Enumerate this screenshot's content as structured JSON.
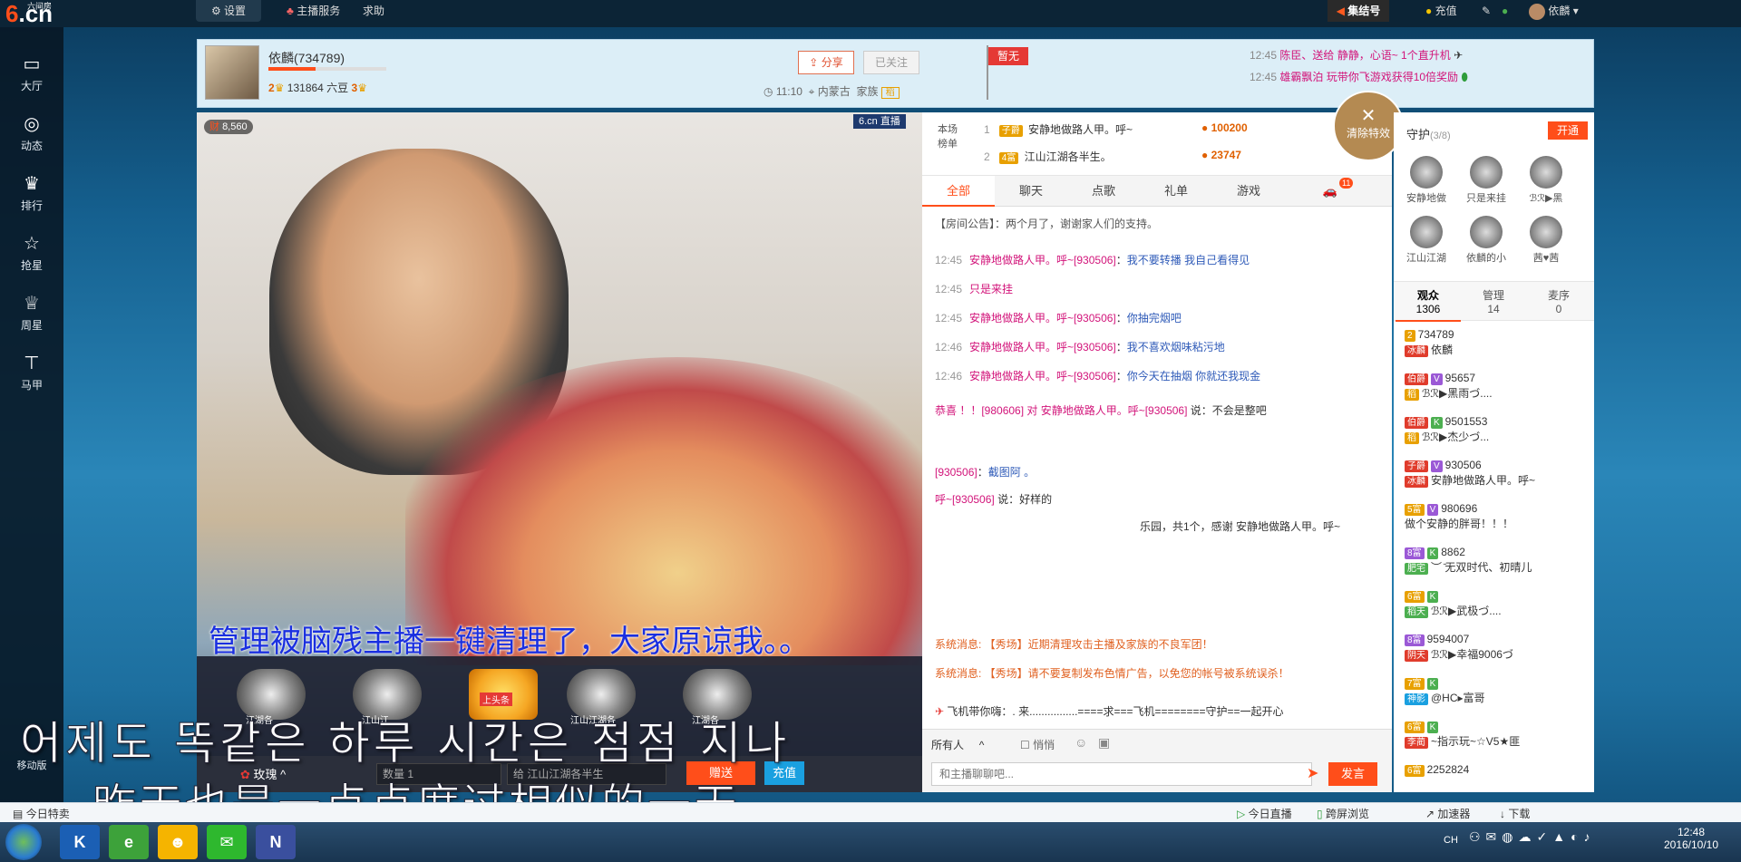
{
  "topbar": {
    "logo_cn": "六间房",
    "logo_text": "6.cn",
    "settings": "设置",
    "anchor_service": "主播服务",
    "help": "求助",
    "jiejie": "集结号",
    "recharge": "充值",
    "user": "依麟"
  },
  "rail": {
    "items": [
      "大厅",
      "动态",
      "排行",
      "抢星",
      "周星",
      "马甲"
    ],
    "mobile": "移动版"
  },
  "header": {
    "anchor_name": "依麟(734789)",
    "level_left": "2",
    "beans": "131864 六豆",
    "level_right": "3",
    "share": "分享",
    "followed": "已关注",
    "time": "11:10",
    "location": "内蒙古",
    "family": "家族",
    "family_badge": "稻",
    "flag": "暂无",
    "feed": [
      {
        "time": "12:45",
        "text": "陈臣、送给 静静，心语~ 1个直升机"
      },
      {
        "time": "12:45",
        "text": "雄霸飘泊 玩带你飞游戏获得10倍奖励"
      }
    ]
  },
  "video": {
    "watermark": "6.cn 直播",
    "wealth_badge": "财",
    "wealth_value": "8,560",
    "gift_labels": [
      "江湖各",
      "江山江",
      "上头条",
      "江山江湖各",
      "江湖各"
    ],
    "gift_name": "玫瑰",
    "quantity_label": "数量",
    "quantity": "1",
    "recipient": "给 江山江湖各半生",
    "give": "赠送",
    "recharge": "充值"
  },
  "rank": {
    "label": "本场榜单",
    "rows": [
      {
        "rank": "1",
        "badge": "子爵",
        "name": "安静地做路人甲。呼~",
        "score": "100200"
      },
      {
        "rank": "2",
        "badge": "4富",
        "name": "江山江湖各半生。",
        "score": "23747"
      }
    ],
    "clear_effects": "清除特效"
  },
  "chat": {
    "tabs": [
      "全部",
      "聊天",
      "点歌",
      "礼单",
      "游戏"
    ],
    "car_badge": "11",
    "announcement": "【房间公告】：两个月了，谢谢家人们的支持。",
    "messages": [
      {
        "time": "12:45",
        "name": "安静地做路人甲。呼~[930506]",
        "text": "我不要转播 我自己看得见"
      },
      {
        "time": "12:45",
        "name": "只是来挂",
        "text": ""
      },
      {
        "time": "12:45",
        "name": "安静地做路人甲。呼~[930506]",
        "text": "你抽完烟吧"
      },
      {
        "time": "12:46",
        "name": "安静地做路人甲。呼~[930506]",
        "text": "我不喜欢烟味粘污地"
      },
      {
        "time": "12:46",
        "name": "安静地做路人甲。呼~[930506]",
        "text": "你今天在抽烟 你就还我现金"
      },
      {
        "time": "",
        "name": "恭喜 ！！[980606] 对 安静地做路人甲。呼~[930506]",
        "text": "说：不会是整吧"
      },
      {
        "time": "",
        "name": "[930506]",
        "text": "截图阿 。"
      },
      {
        "time": "",
        "name": "呼~[930506]",
        "text": "说：好样的"
      },
      {
        "time": "",
        "name": "乐园，共1个，感谢 安静地做路人甲。呼~",
        "text": ""
      }
    ],
    "sys1": "系统消息: 【秀场】近期清理攻击主播及家族的不良军团！",
    "sys2": "系统消息: 【秀场】请不要复制发布色情广告，以免您的帐号被系统误杀！",
    "plane": "飞机带你嗨：. 来................====求===飞机========守护==一起开心",
    "to_all": "所有人",
    "whisper": "悄悄",
    "input_placeholder": "和主播聊聊吧...",
    "send": "发言"
  },
  "guard": {
    "title": "守护",
    "count": "(3/8)",
    "open": "开通",
    "members": [
      "安静地做",
      "只是来挂",
      "ℬℛ▶黑",
      "江山江湖",
      "依麟的小",
      "茜♥茜"
    ]
  },
  "audience": {
    "tabs": [
      {
        "label": "观众",
        "count": "1306"
      },
      {
        "label": "管理",
        "count": "14"
      },
      {
        "label": "麦序",
        "count": "0"
      }
    ],
    "list": [
      {
        "id": "734789",
        "badge": "冰麟",
        "name": "依麟"
      },
      {
        "id": "95657",
        "badge": "稻",
        "name": "ℬℛ▶黑雨づ...."
      },
      {
        "id": "9501553",
        "badge": "稻",
        "name": "ℬℛ▶杰少づ..."
      },
      {
        "id": "930506",
        "badge": "冰麟",
        "name": "安静地做路人甲。呼~"
      },
      {
        "id": "980696",
        "badge": "",
        "name": "做个安静的胖哥！！！"
      },
      {
        "id": "8862",
        "badge": "肥宅",
        "name": "︶ ̄无双时代、初晴儿"
      },
      {
        "id": "",
        "badge": "稻天",
        "name": "ℬℛ▶武极づ...."
      },
      {
        "id": "9594007",
        "badge": "阴天",
        "name": "ℬℛ▶幸福9006づ"
      },
      {
        "id": "",
        "badge": "神影",
        "name": "@HC▸富哥"
      },
      {
        "id": "",
        "badge": "李蔺",
        "name": "~指示玩~☆V5★匪"
      },
      {
        "id": "2252824",
        "badge": "",
        "name": ""
      }
    ]
  },
  "statusbar": {
    "left": "今日特卖",
    "live_today": "今日直播",
    "cross_browse": "跨屏浏览",
    "accelerator": "加速器",
    "download": "下载"
  },
  "taskbar": {
    "lang": "CH",
    "time": "12:48",
    "date": "2016/10/10"
  },
  "subtitles": {
    "line1": "管理被脑残主播一键清理了，大家原谅我。。",
    "line2": "어제도 똑같은 하루 시간은 점점 지나",
    "line3": "昨天也是一点点度过相似的一天"
  }
}
